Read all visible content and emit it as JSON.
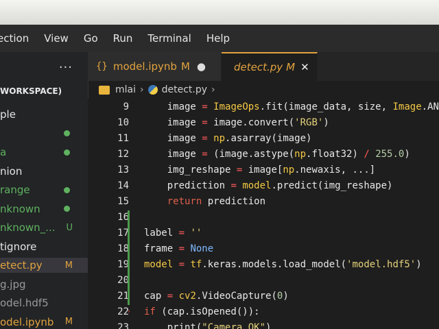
{
  "menu": [
    "ection",
    "View",
    "Go",
    "Run",
    "Terminal",
    "Help"
  ],
  "sidebar": {
    "more": "···",
    "workspace_label": "WORKSPACE)",
    "items": [
      {
        "label": "ple",
        "marker": ""
      },
      {
        "label": "",
        "marker": "dot"
      },
      {
        "label": "a",
        "marker": "dot"
      },
      {
        "label": "nion",
        "marker": ""
      },
      {
        "label": "range",
        "marker": "dot"
      },
      {
        "label": "nknown",
        "marker": "dot"
      },
      {
        "label": "nknown_...",
        "marker": "U"
      },
      {
        "label": "tignore",
        "marker": ""
      },
      {
        "label": "etect.py",
        "marker": "M"
      },
      {
        "label": "g.jpg",
        "marker": ""
      },
      {
        "label": "odel.hdf5",
        "marker": ""
      },
      {
        "label": "odel.ipynb",
        "marker": "M"
      }
    ]
  },
  "tabs": [
    {
      "icon": "notebook-icon",
      "label": "model.ipynb",
      "marker": "M",
      "state": "●"
    },
    {
      "icon": "python-icon",
      "label": "detect.py",
      "marker": "M",
      "state": "✕"
    }
  ],
  "breadcrumb": {
    "folder": "mlai",
    "file": "detect.py",
    "trail": "›"
  },
  "colors": {
    "modified": "#e2a33f",
    "untracked": "#5fb25f",
    "accent": "#e2a33f"
  },
  "code": {
    "line_numbers": [
      "9",
      "10",
      "11",
      "12",
      "13",
      "14",
      "15",
      "16",
      "17",
      "18",
      "19",
      "20",
      "21",
      "22",
      "23"
    ],
    "lines": [
      "    image = ImageOps.fit(image_data, size, Image.ANTIA",
      "    image = image.convert('RGB')",
      "    image = np.asarray(image)",
      "    image = (image.astype(np.float32) / 255.0)",
      "    img_reshape = image[np.newaxis, ...]",
      "    prediction = model.predict(img_reshape)",
      "    return prediction",
      "",
      "label = ''",
      "frame = None",
      "model = tf.keras.models.load_model('model.hdf5')",
      "",
      "cap = cv2.VideoCapture(0)",
      "if (cap.isOpened()):",
      "    print(\"Camera OK\")"
    ]
  }
}
